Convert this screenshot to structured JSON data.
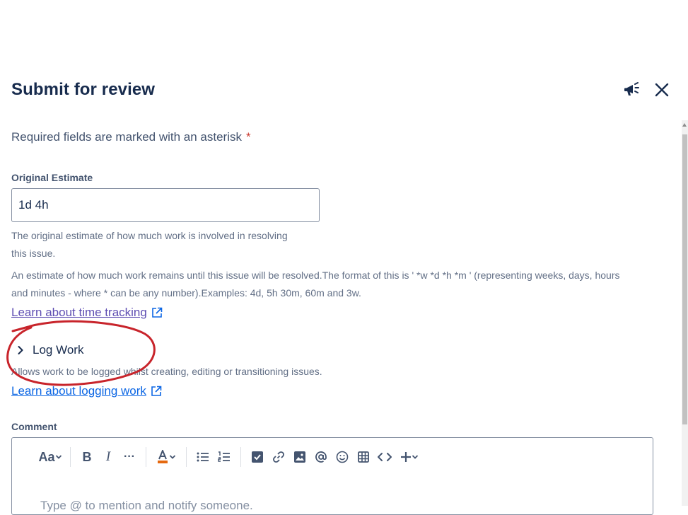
{
  "header": {
    "title": "Submit for review",
    "feedback_icon": "megaphone-icon",
    "close_icon": "close-icon"
  },
  "form": {
    "required_note": "Required fields are marked with an asterisk",
    "required_star": "*",
    "original_estimate": {
      "label": "Original Estimate",
      "value": "1d 4h",
      "help_line1": "The original estimate of how much work is involved in resolving",
      "help_line2": "this issue.",
      "format_line1": "An estimate of how much work remains until this issue will be resolved.The format of this is ' *w *d *h *m ' (representing weeks, days, hours",
      "format_line2": "and minutes - where * can be any number).Examples: 4d, 5h 30m, 60m and 3w.",
      "learn_link": "Learn about time tracking"
    },
    "log_work": {
      "label": "Log Work",
      "description": "Allows work to be logged whilst creating, editing or transitioning issues.",
      "learn_link": "Learn about logging work"
    },
    "comment": {
      "label": "Comment",
      "placeholder": "Type @ to mention and notify someone.",
      "toolbar": {
        "text_style": "Aa",
        "bold": "B",
        "italic": "I",
        "more": "···"
      }
    }
  },
  "colors": {
    "heading": "#172b4d",
    "link": "#0c66e4",
    "visited_link": "#5e4db2",
    "required_star": "#c9372c",
    "annotation_circle": "#c8242b"
  }
}
